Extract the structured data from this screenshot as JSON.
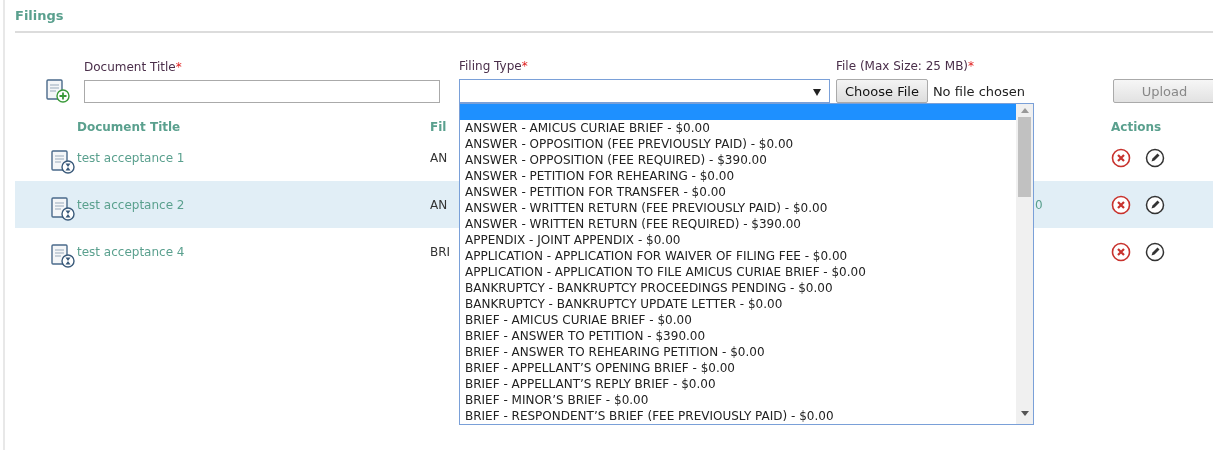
{
  "section_title": "Filings",
  "form": {
    "document_title": {
      "label": "Document Title",
      "required_mark": "*"
    },
    "filing_type": {
      "label": "Filing Type",
      "required_mark": "*",
      "open": true
    },
    "file": {
      "label": "File (Max Size: 25 MB)",
      "required_mark": "*",
      "button": "Choose File",
      "status": "No file chosen"
    },
    "upload_button": {
      "label": "Upload",
      "disabled": true
    }
  },
  "dropdown": {
    "blank_option_highlighted": true,
    "options": [
      {
        "label": "ANSWER - AMICUS CURIAE BRIEF - $0.00",
        "selected": false
      },
      {
        "label": "ANSWER - OPPOSITION (FEE PREVIOUSLY PAID) - $0.00",
        "selected": false
      },
      {
        "label": "ANSWER - OPPOSITION (FEE REQUIRED) - $390.00",
        "selected": false
      },
      {
        "label": "ANSWER - PETITION FOR REHEARING - $0.00",
        "selected": false
      },
      {
        "label": "ANSWER - PETITION FOR TRANSFER - $0.00",
        "selected": false
      },
      {
        "label": "ANSWER - WRITTEN RETURN (FEE PREVIOUSLY PAID) - $0.00",
        "selected": false
      },
      {
        "label": "ANSWER - WRITTEN RETURN (FEE REQUIRED) - $390.00",
        "selected": false
      },
      {
        "label": "APPENDIX - JOINT APPENDIX - $0.00",
        "selected": false
      },
      {
        "label": "APPLICATION - APPLICATION FOR WAIVER OF FILING FEE - $0.00",
        "selected": false
      },
      {
        "label": "APPLICATION - APPLICATION TO FILE AMICUS CURIAE BRIEF - $0.00",
        "selected": false
      },
      {
        "label": "BANKRUPTCY - BANKRUPTCY PROCEEDINGS PENDING - $0.00",
        "selected": false
      },
      {
        "label": "BANKRUPTCY - BANKRUPTCY UPDATE LETTER - $0.00",
        "selected": false
      },
      {
        "label": "BRIEF - AMICUS CURIAE BRIEF - $0.00",
        "selected": false
      },
      {
        "label": "BRIEF - ANSWER TO PETITION - $390.00",
        "selected": false
      },
      {
        "label": "BRIEF - ANSWER TO REHEARING PETITION - $0.00",
        "selected": false
      },
      {
        "label": "BRIEF - APPELLANT’S OPENING BRIEF - $0.00",
        "selected": false
      },
      {
        "label": "BRIEF - APPELLANT’S REPLY BRIEF - $0.00",
        "selected": false
      },
      {
        "label": "BRIEF - MINOR’S BRIEF - $0.00",
        "selected": false
      },
      {
        "label": "BRIEF - RESPONDENT’S BRIEF (FEE PREVIOUSLY PAID) - $0.00",
        "selected": false
      }
    ]
  },
  "table": {
    "columns": [
      "Document Title",
      "Fil",
      "Actions"
    ],
    "rows": [
      {
        "title": "test acceptance 1",
        "column_2": "AN",
        "selected": false
      },
      {
        "title": "test acceptance 2",
        "column_2": "AN",
        "column_3": "0",
        "selected": true
      },
      {
        "title": "test acceptance 4",
        "column_2": "BRI",
        "selected": false
      }
    ]
  }
}
